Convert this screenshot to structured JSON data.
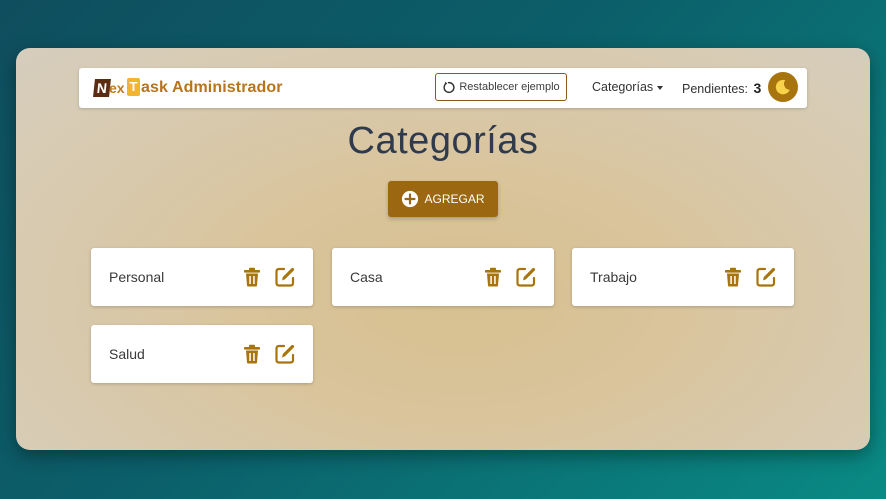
{
  "navbar": {
    "logo_n": "N",
    "logo_ex": "ex",
    "logo_t": "T",
    "brand_text": "ask Administrador",
    "reset_label": "Restablecer ejemplo",
    "categories_menu_label": "Categorías",
    "pending_label": "Pendientes:",
    "pending_count": "3",
    "theme_toggle_icon": "moon-icon"
  },
  "page": {
    "title": "Categorías",
    "add_button_label": "AGREGAR",
    "add_icon": "plus-circle-icon"
  },
  "categories": [
    {
      "name": "Personal"
    },
    {
      "name": "Casa"
    },
    {
      "name": "Trabajo"
    },
    {
      "name": "Salud"
    }
  ],
  "colors": {
    "accent": "#9b6710",
    "title": "#2f3b4c",
    "icon": "#a7740d",
    "brand": "#b8741a"
  }
}
